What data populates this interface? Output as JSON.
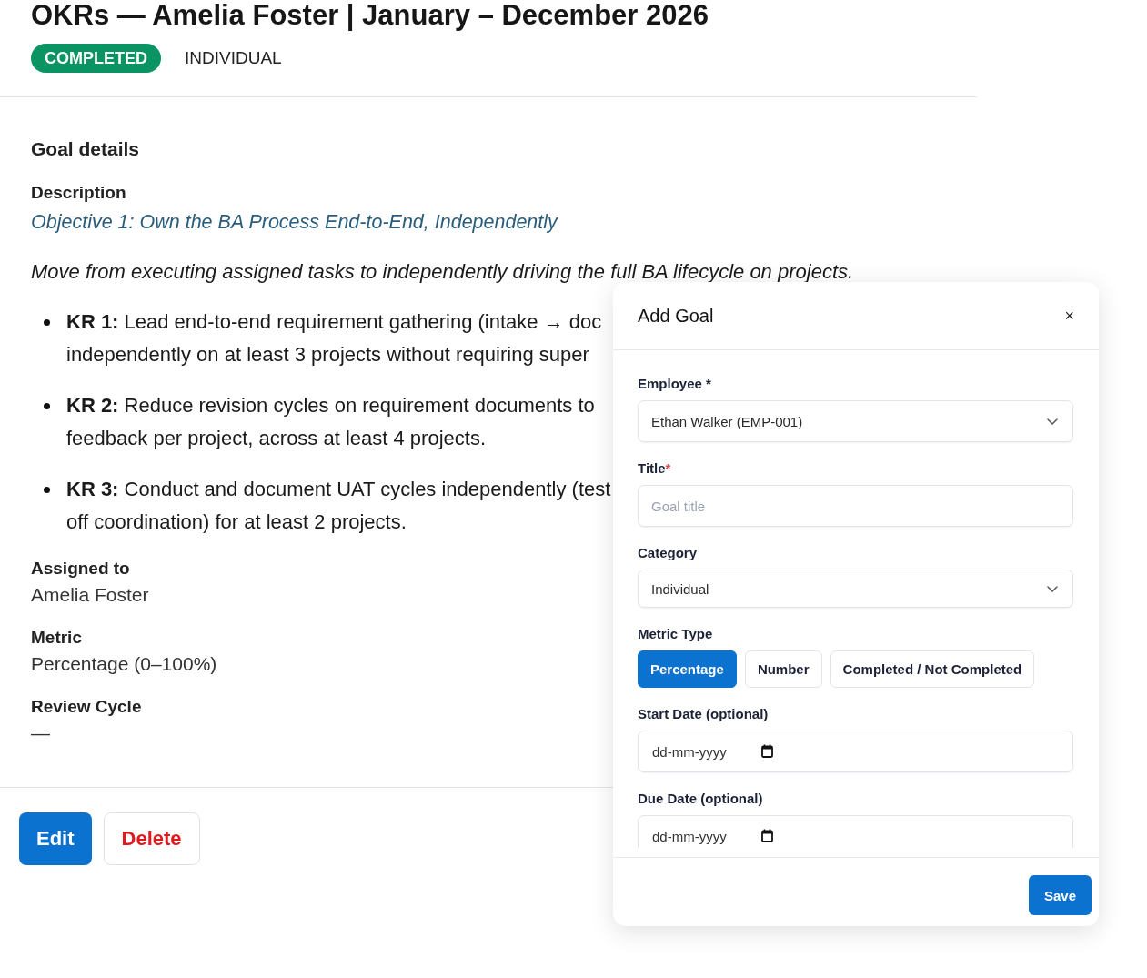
{
  "header": {
    "title": "OKRs — Amelia Foster | January – December 2026",
    "status": "COMPLETED",
    "category": "INDIVIDUAL"
  },
  "details": {
    "heading": "Goal details",
    "description_label": "Description",
    "objective": "Objective 1: Own the BA Process End-to-End, Independently",
    "summary": "Move from executing assigned tasks to independently driving the full BA lifecycle on projects.",
    "key_results": [
      {
        "lines": [
          "**KR 1:** Lead end-to-end requirement gathering (intake → doc",
          "independently on at least 3 projects without requiring super"
        ]
      },
      {
        "lines": [
          "**KR 2:** Reduce revision cycles on requirement documents to",
          "feedback per project, across at least 4 projects."
        ]
      },
      {
        "lines": [
          "**KR 3:** Conduct and document UAT cycles independently (test",
          "off coordination) for at least 2 projects."
        ]
      }
    ],
    "fields": [
      {
        "label": "Assigned to",
        "value": "Amelia Foster"
      },
      {
        "label": "Metric",
        "value": "Percentage (0–100%)"
      },
      {
        "label": "Review Cycle",
        "value": "—"
      }
    ]
  },
  "actions": [
    {
      "kind": "primary",
      "label": "Edit"
    },
    {
      "kind": "danger",
      "label": "Delete"
    }
  ],
  "modal": {
    "title": "Add Goal",
    "close": "×",
    "save": "Save",
    "fields": [
      {
        "kind": "select",
        "label": "Employee *",
        "value": "Ethan Walker (EMP-001)"
      },
      {
        "kind": "text",
        "label": "Title",
        "required_mark": "*",
        "placeholder": "Goal title"
      },
      {
        "kind": "select",
        "label": "Category",
        "value": "Individual"
      },
      {
        "kind": "segmented",
        "label": "Metric Type",
        "options": [
          {
            "label": "Percentage",
            "selected": true
          },
          {
            "label": "Number",
            "selected": false
          },
          {
            "label": "Completed / Not Completed",
            "selected": false
          }
        ]
      },
      {
        "kind": "date",
        "label": "Start Date (optional)",
        "placeholder": "dd-mm-yyyy"
      },
      {
        "kind": "date",
        "label": "Due Date (optional)",
        "placeholder": "dd-mm-yyyy"
      }
    ]
  }
}
